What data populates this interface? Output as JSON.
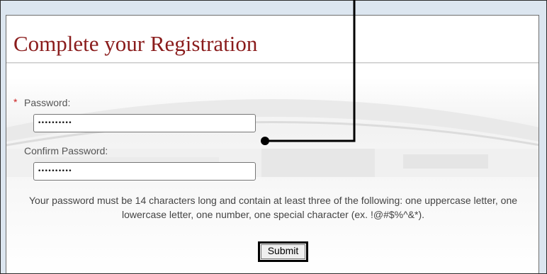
{
  "page": {
    "title": "Complete your Registration"
  },
  "form": {
    "password": {
      "required_mark": "*",
      "label": "Password:",
      "value": "••••••••••"
    },
    "confirm_password": {
      "label": "Confirm Password:",
      "value": "••••••••••"
    },
    "hint": "Your password must be 14 characters long and contain at least three of the following: one uppercase letter, one lowercase letter, one number, one special character (ex. !@#$%^&*).",
    "submit_label": "Submit"
  },
  "colors": {
    "title": "#8a1c1c",
    "required_mark": "#cc2020",
    "bezel": "#dce6f0",
    "annotation": "#000000"
  }
}
